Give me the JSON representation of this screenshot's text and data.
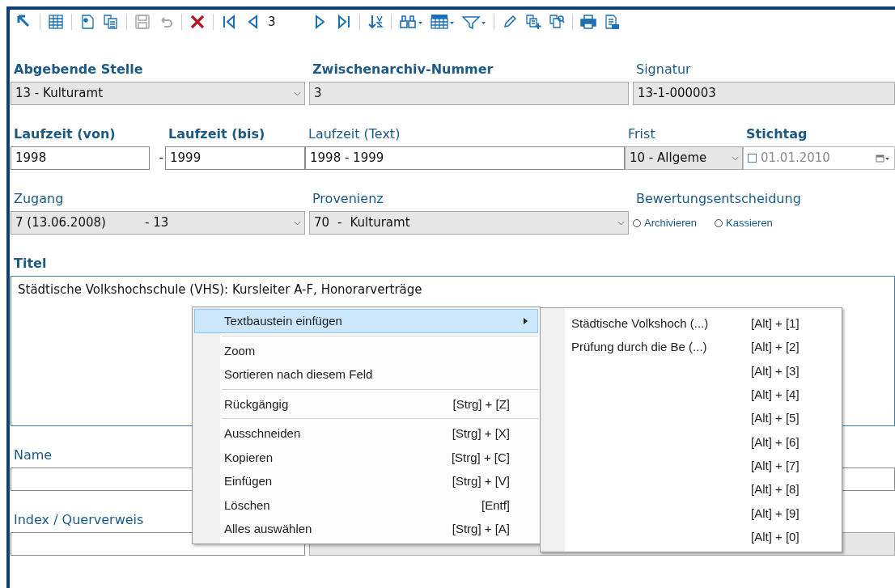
{
  "toolbar": [
    {
      "kind": "back",
      "disabled": false
    },
    {
      "kind": "sep"
    },
    {
      "kind": "grid",
      "disabled": false
    },
    {
      "kind": "sep"
    },
    {
      "kind": "new",
      "disabled": false
    },
    {
      "kind": "copy",
      "disabled": false
    },
    {
      "kind": "sep"
    },
    {
      "kind": "save",
      "disabled": true
    },
    {
      "kind": "undo",
      "disabled": true
    },
    {
      "kind": "sep"
    },
    {
      "kind": "delete",
      "disabled": false
    },
    {
      "kind": "sep"
    },
    {
      "kind": "first",
      "disabled": false
    },
    {
      "kind": "prev",
      "disabled": false
    },
    {
      "kind": "record",
      "text": "3"
    },
    {
      "kind": "next",
      "disabled": false
    },
    {
      "kind": "last",
      "disabled": false
    },
    {
      "kind": "sep"
    },
    {
      "kind": "sort",
      "disabled": false
    },
    {
      "kind": "sep"
    },
    {
      "kind": "find",
      "disabled": false
    },
    {
      "kind": "calendar",
      "disabled": false
    },
    {
      "kind": "filter",
      "disabled": false
    },
    {
      "kind": "sep"
    },
    {
      "kind": "edit",
      "disabled": false
    },
    {
      "kind": "add-copy",
      "disabled": false
    },
    {
      "kind": "find-copy",
      "disabled": false
    },
    {
      "kind": "sep"
    },
    {
      "kind": "print",
      "disabled": false
    },
    {
      "kind": "report",
      "disabled": false
    }
  ],
  "form": [
    [
      {
        "kind": "select",
        "label": "Abgebende Stelle",
        "required": true,
        "parts": [
          "13 - Kulturamt"
        ]
      },
      {
        "kind": "readonly",
        "label": "Zwischenarchiv-Nummer",
        "required": true,
        "value": "3"
      },
      {
        "kind": "readonly",
        "label": "Signatur",
        "required": false,
        "value": "13-1-000003"
      }
    ],
    [
      {
        "kind": "text",
        "label": "Laufzeit (von)",
        "required": true,
        "value": "1998"
      },
      {
        "kind": "dash",
        "text": "-"
      },
      {
        "kind": "text",
        "label": "Laufzeit (bis)",
        "required": true,
        "value": "1999"
      },
      {
        "kind": "text",
        "label": "Laufzeit (Text)",
        "required": false,
        "value": "1998 - 1999"
      },
      {
        "kind": "select",
        "label": "Frist",
        "required": false,
        "parts": [
          "10 - Allgeme"
        ]
      },
      {
        "kind": "date",
        "label": "Stichtag",
        "required": true,
        "checked": false,
        "value": "01.01.2010"
      }
    ],
    [
      {
        "kind": "select",
        "label": "Zugang",
        "required": false,
        "parts": [
          "7 (13.06.2008)",
          "- 13"
        ]
      },
      {
        "kind": "select",
        "label": "Provenienz",
        "required": false,
        "parts": [
          "70",
          "-",
          "Kulturamt"
        ]
      },
      {
        "kind": "radios",
        "label": "Bewertungsentscheidung",
        "required": false,
        "options": [
          {
            "label": "Archivieren",
            "selected": false
          },
          {
            "label": "Kassieren",
            "selected": false
          }
        ]
      }
    ],
    [
      {
        "kind": "textarea",
        "label": "Titel",
        "required": true,
        "value": "Städtische Volkshochschule (VHS): Kursleiter A-F, Honorarverträge"
      }
    ],
    [
      {
        "kind": "text",
        "label": "Name",
        "required": false
      },
      {
        "kind": "text"
      }
    ],
    [
      {
        "kind": "text",
        "label": "Index / Querverweis",
        "required": false
      },
      {
        "kind": "readonly"
      }
    ]
  ],
  "context_menu": [
    {
      "kind": "item",
      "label": "Textbaustein einfügen",
      "submenu": true,
      "selected": true
    },
    {
      "kind": "separator"
    },
    {
      "kind": "item",
      "label": "Zoom",
      "submenu": false,
      "selected": false
    },
    {
      "kind": "item",
      "label": "Sortieren nach diesem Feld",
      "submenu": false,
      "selected": false
    },
    {
      "kind": "separator"
    },
    {
      "kind": "item",
      "label": "Rückgängig",
      "shortcut": "[Strg] + [Z]",
      "submenu": false,
      "selected": false
    },
    {
      "kind": "separator"
    },
    {
      "kind": "item",
      "label": "Ausschneiden",
      "shortcut": "[Strg] + [X]",
      "submenu": false,
      "selected": false
    },
    {
      "kind": "item",
      "label": "Kopieren",
      "shortcut": "[Strg] + [C]",
      "submenu": false,
      "selected": false
    },
    {
      "kind": "item",
      "label": "Einfügen",
      "shortcut": "[Strg] + [V]",
      "submenu": false,
      "selected": false
    },
    {
      "kind": "item",
      "label": "Löschen",
      "shortcut": "[Entf]",
      "submenu": false,
      "selected": false
    },
    {
      "kind": "item",
      "label": "Alles auswählen",
      "shortcut": "[Strg] + [A]",
      "submenu": false,
      "selected": false
    }
  ],
  "submenu": [
    {
      "label": "Städtische Volkshoch (...)",
      "shortcut": "[Alt] + [1]"
    },
    {
      "label": "Prüfung durch die Be (...)",
      "shortcut": "[Alt] + [2]"
    },
    {
      "shortcut": "[Alt] + [3]"
    },
    {
      "shortcut": "[Alt] + [4]"
    },
    {
      "shortcut": "[Alt] + [5]"
    },
    {
      "shortcut": "[Alt] + [6]"
    },
    {
      "shortcut": "[Alt] + [7]"
    },
    {
      "shortcut": "[Alt] + [8]"
    },
    {
      "shortcut": "[Alt] + [9]"
    },
    {
      "shortcut": "[Alt] + [0]"
    }
  ]
}
